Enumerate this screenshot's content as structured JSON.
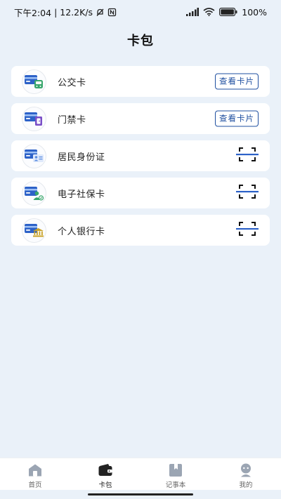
{
  "status_bar": {
    "time": "下午2:04",
    "separator": "|",
    "net_speed": "12.2K/s",
    "battery_text": "100%"
  },
  "page": {
    "title": "卡包"
  },
  "cards": [
    {
      "label": "公交卡",
      "icon": "bus-card-icon",
      "action": "view",
      "action_label": "查看卡片"
    },
    {
      "label": "门禁卡",
      "icon": "access-card-icon",
      "action": "view",
      "action_label": "查看卡片"
    },
    {
      "label": "居民身份证",
      "icon": "id-card-icon",
      "action": "scan"
    },
    {
      "label": "电子社保卡",
      "icon": "social-security-card-icon",
      "action": "scan"
    },
    {
      "label": "个人银行卡",
      "icon": "bank-card-icon",
      "action": "scan"
    }
  ],
  "nav": [
    {
      "label": "首页",
      "icon": "home-icon",
      "active": false
    },
    {
      "label": "卡包",
      "icon": "wallet-icon",
      "active": true
    },
    {
      "label": "记事本",
      "icon": "notebook-icon",
      "active": false
    },
    {
      "label": "我的",
      "icon": "profile-icon",
      "active": false
    }
  ],
  "colors": {
    "background": "#eaf1f9",
    "accent_blue": "#1f4fa0",
    "card_blue": "#2d62c8",
    "green": "#3aa76d",
    "purple": "#7a4fc7",
    "gold": "#c9a227"
  }
}
